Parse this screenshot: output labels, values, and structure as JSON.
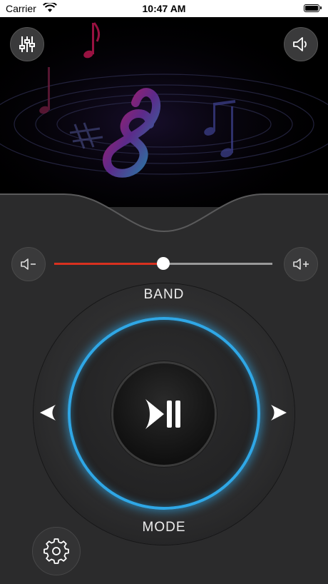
{
  "status_bar": {
    "carrier": "Carrier",
    "time": "10:47 AM"
  },
  "icons": {
    "equalizer": "equalizer-icon",
    "speaker": "speaker-icon",
    "volume_down": "volume-down-icon",
    "volume_up": "volume-up-icon",
    "prev": "arrow-left-icon",
    "next": "arrow-right-icon",
    "play_pause": "play-pause-icon",
    "settings": "gear-icon"
  },
  "volume": {
    "level": 0.5
  },
  "controls": {
    "band_label": "BAND",
    "mode_label": "MODE"
  },
  "colors": {
    "accent_ring": "#2fa7e6",
    "slider_fill": "#d8311f"
  }
}
